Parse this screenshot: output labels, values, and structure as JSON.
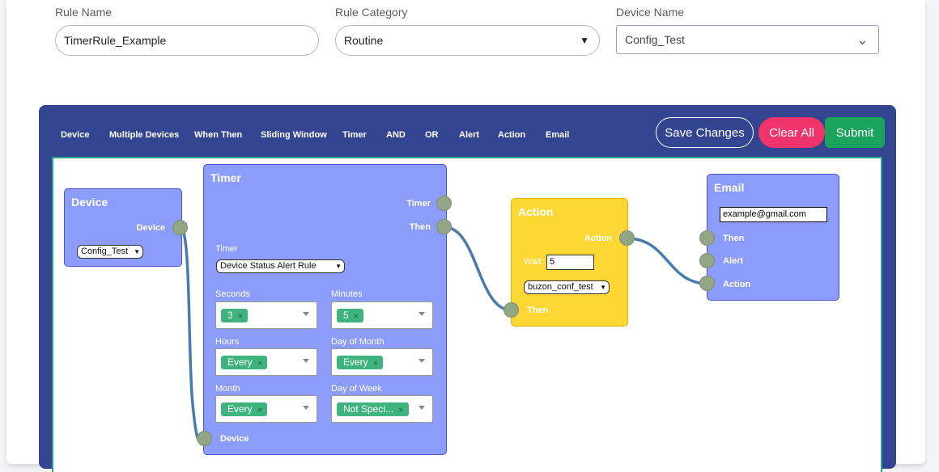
{
  "form": {
    "rule_name_label": "Rule Name",
    "rule_name_value": "TimerRule_Example",
    "rule_category_label": "Rule Category",
    "rule_category_value": "Routine",
    "device_name_label": "Device Name",
    "device_name_value": "Config_Test"
  },
  "toolbar": {
    "items": [
      "Device",
      "Multiple Devices",
      "When Then",
      "Sliding Window",
      "Timer",
      "AND",
      "OR",
      "Alert",
      "Action",
      "Email"
    ],
    "save_label": "Save Changes",
    "clear_label": "Clear All",
    "submit_label": "Submit"
  },
  "colors": {
    "builder_bg": "#334591",
    "node_blue": "#8b9cfa",
    "node_yellow": "#fdd835",
    "clear_button": "#f0336b",
    "submit_button": "#1aa35c",
    "chip_green": "#3eb37e",
    "wire": "#4a7cab"
  },
  "nodes": {
    "device": {
      "title": "Device",
      "out_label": "Device",
      "select_value": "Config_Test"
    },
    "timer": {
      "title": "Timer",
      "out_timer_label": "Timer",
      "out_then_label": "Then",
      "timer_label": "Timer",
      "timer_select": "Device Status Alert Rule",
      "seconds_label": "Seconds",
      "seconds_value": "3",
      "minutes_label": "Minutes",
      "minutes_value": "5",
      "hours_label": "Hours",
      "hours_value": "Every",
      "day_of_month_label": "Day of Month",
      "day_of_month_value": "Every",
      "month_label": "Month",
      "month_value": "Every",
      "day_of_week_label": "Day of Week",
      "day_of_week_value": "Not Speci...",
      "in_device_label": "Device"
    },
    "action": {
      "title": "Action",
      "out_action_label": "Action",
      "wait_label": "Wait:",
      "wait_value": "5",
      "select_value": "buzon_conf_test",
      "in_then_label": "Then"
    },
    "email": {
      "title": "Email",
      "email_value": "example@gmail.com",
      "in_then_label": "Then",
      "in_alert_label": "Alert",
      "in_action_label": "Action"
    }
  },
  "icons": {
    "chip_remove": "×",
    "dropdown": "▾",
    "chevron_down": "⌄"
  }
}
